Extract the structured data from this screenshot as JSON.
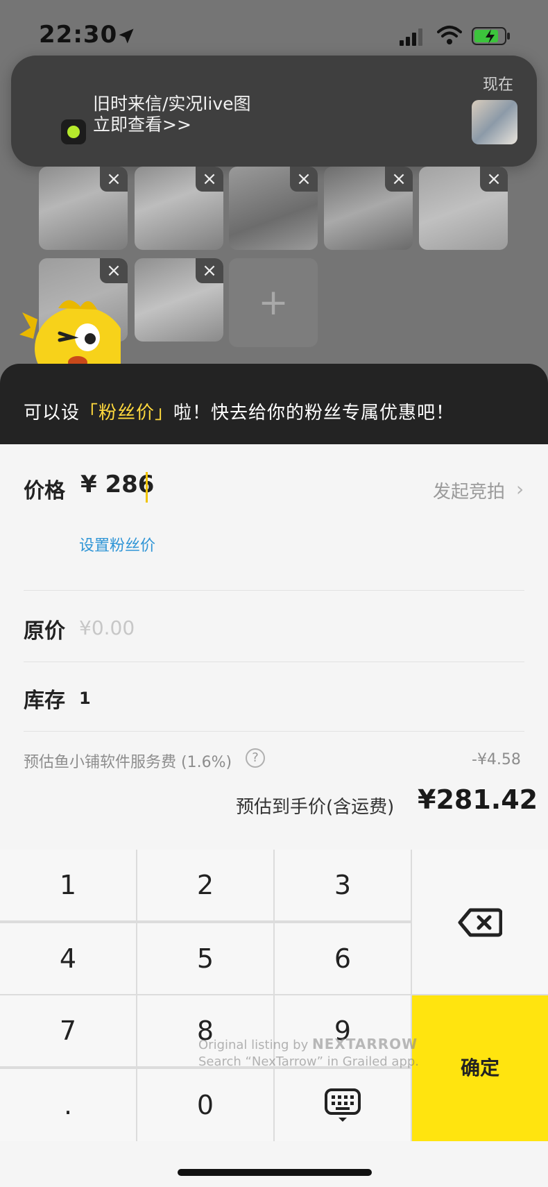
{
  "status_bar": {
    "time": "22:30"
  },
  "notification": {
    "line1": "旧时来信/实况live图",
    "line2": "立即查看>>",
    "time": "现在"
  },
  "photos": {
    "add_symbol": "+",
    "close_symbol": "×"
  },
  "tip_banner": {
    "prefix": "可以设",
    "highlight": "「粉丝价」",
    "suffix": "啦！快去给你的粉丝专属优惠吧！"
  },
  "form": {
    "price_label": "价格",
    "price_value": "¥ 286",
    "auction_label": "发起竞拍",
    "fan_price_link": "设置粉丝价",
    "original_label": "原价",
    "original_placeholder": "¥0.00",
    "stock_label": "库存",
    "stock_value": "1",
    "fee_label": "预估鱼小铺软件服务费 (1.6%)",
    "fee_value": "-¥4.58",
    "net_label": "预估到手价(含运费)",
    "net_value": "¥281.42"
  },
  "keypad": {
    "keys": [
      "1",
      "2",
      "3",
      "4",
      "5",
      "6",
      "7",
      "8",
      "9",
      ".",
      "0"
    ],
    "confirm_label": "确定"
  },
  "watermark": {
    "line1_prefix": "Original listing by",
    "brand": "NEXTARROW",
    "line2": "Search “NexTarrow” in Grailed app."
  },
  "colors": {
    "accent_yellow": "#ffe40f",
    "link_blue": "#2f95d6",
    "highlight_yellow": "#ffd93d"
  }
}
